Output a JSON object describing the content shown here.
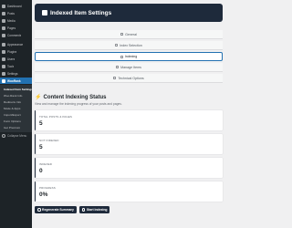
{
  "sidebar": {
    "items": [
      {
        "label": "Dashboard",
        "icon": "dashboard-icon"
      },
      {
        "label": "Posts",
        "icon": "pin-icon"
      },
      {
        "label": "Media",
        "icon": "media-icon"
      },
      {
        "label": "Pages",
        "icon": "page-icon"
      },
      {
        "label": "Comments",
        "icon": "comment-icon"
      },
      {
        "label": "Appearance",
        "icon": "brush-icon"
      },
      {
        "label": "Plugins",
        "icon": "plug-icon"
      },
      {
        "label": "Users",
        "icon": "user-icon"
      },
      {
        "label": "Tools",
        "icon": "wrench-icon"
      },
      {
        "label": "Settings",
        "icon": "sliders-icon"
      },
      {
        "label": "WooRank",
        "icon": "plugin-icon"
      }
    ],
    "submenu": [
      "Indexed Item Settings",
      "Woo Rank Info",
      "Redirects Info",
      "Mode & Apps",
      "Import/Export",
      "Form Options",
      "Get Premium"
    ],
    "collapse_label": "Collapse Menu"
  },
  "header": {
    "title": "Indexed Item Settings",
    "icon": "gear-icon"
  },
  "tabs": [
    {
      "label": "General",
      "icon": "general-icon"
    },
    {
      "label": "Index Selection",
      "icon": "list-icon"
    },
    {
      "label": "Indexing",
      "icon": "index-icon"
    },
    {
      "label": "Manage Items",
      "icon": "grid-icon"
    },
    {
      "label": "Technical Options",
      "icon": "settings-icon"
    }
  ],
  "section": {
    "title": "Content Indexing Status",
    "description": "View and manage the indexing progress of your posts and pages."
  },
  "stats": [
    {
      "label": "TOTAL POSTS & PAGES",
      "value": "5"
    },
    {
      "label": "NOT INDEXED",
      "value": "5"
    },
    {
      "label": "INDEXED",
      "value": "0"
    },
    {
      "label": "PROGRESS",
      "value": "0%"
    }
  ],
  "buttons": {
    "regenerate": "Regenerate Summary",
    "start": "Start Indexing"
  }
}
